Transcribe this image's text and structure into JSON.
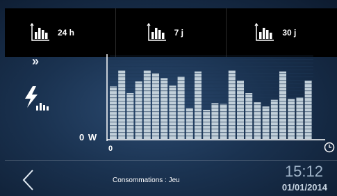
{
  "tabs": [
    {
      "id": "24h",
      "label": "24 h",
      "icon": "bar-chart-icon"
    },
    {
      "id": "7j",
      "label": "7 j",
      "icon": "bar-chart-icon"
    },
    {
      "id": "30j",
      "label": "30 j",
      "icon": "bar-chart-icon"
    }
  ],
  "left_panel": {
    "expand_icon": "double-chevron-icon",
    "energy_icon": "lightning-bolt-bars-icon"
  },
  "chart_data": {
    "type": "bar",
    "y_zero_label": "0 W",
    "x_start_label": "0",
    "x_end_icon": "clock-icon",
    "values": [
      0.63,
      0.82,
      0.55,
      0.69,
      0.82,
      0.79,
      0.73,
      0.64,
      0.75,
      0.37,
      0.81,
      0.35,
      0.43,
      0.42,
      0.82,
      0.7,
      0.55,
      0.44,
      0.39,
      0.47,
      0.81,
      0.48,
      0.5,
      0.7
    ],
    "color": "#c2d0da",
    "ylim": [
      0,
      1
    ]
  },
  "bottom": {
    "back_icon": "back-chevron-icon",
    "title": "Consommations : Jeu",
    "time": "15:12",
    "date": "01/01/2014"
  }
}
